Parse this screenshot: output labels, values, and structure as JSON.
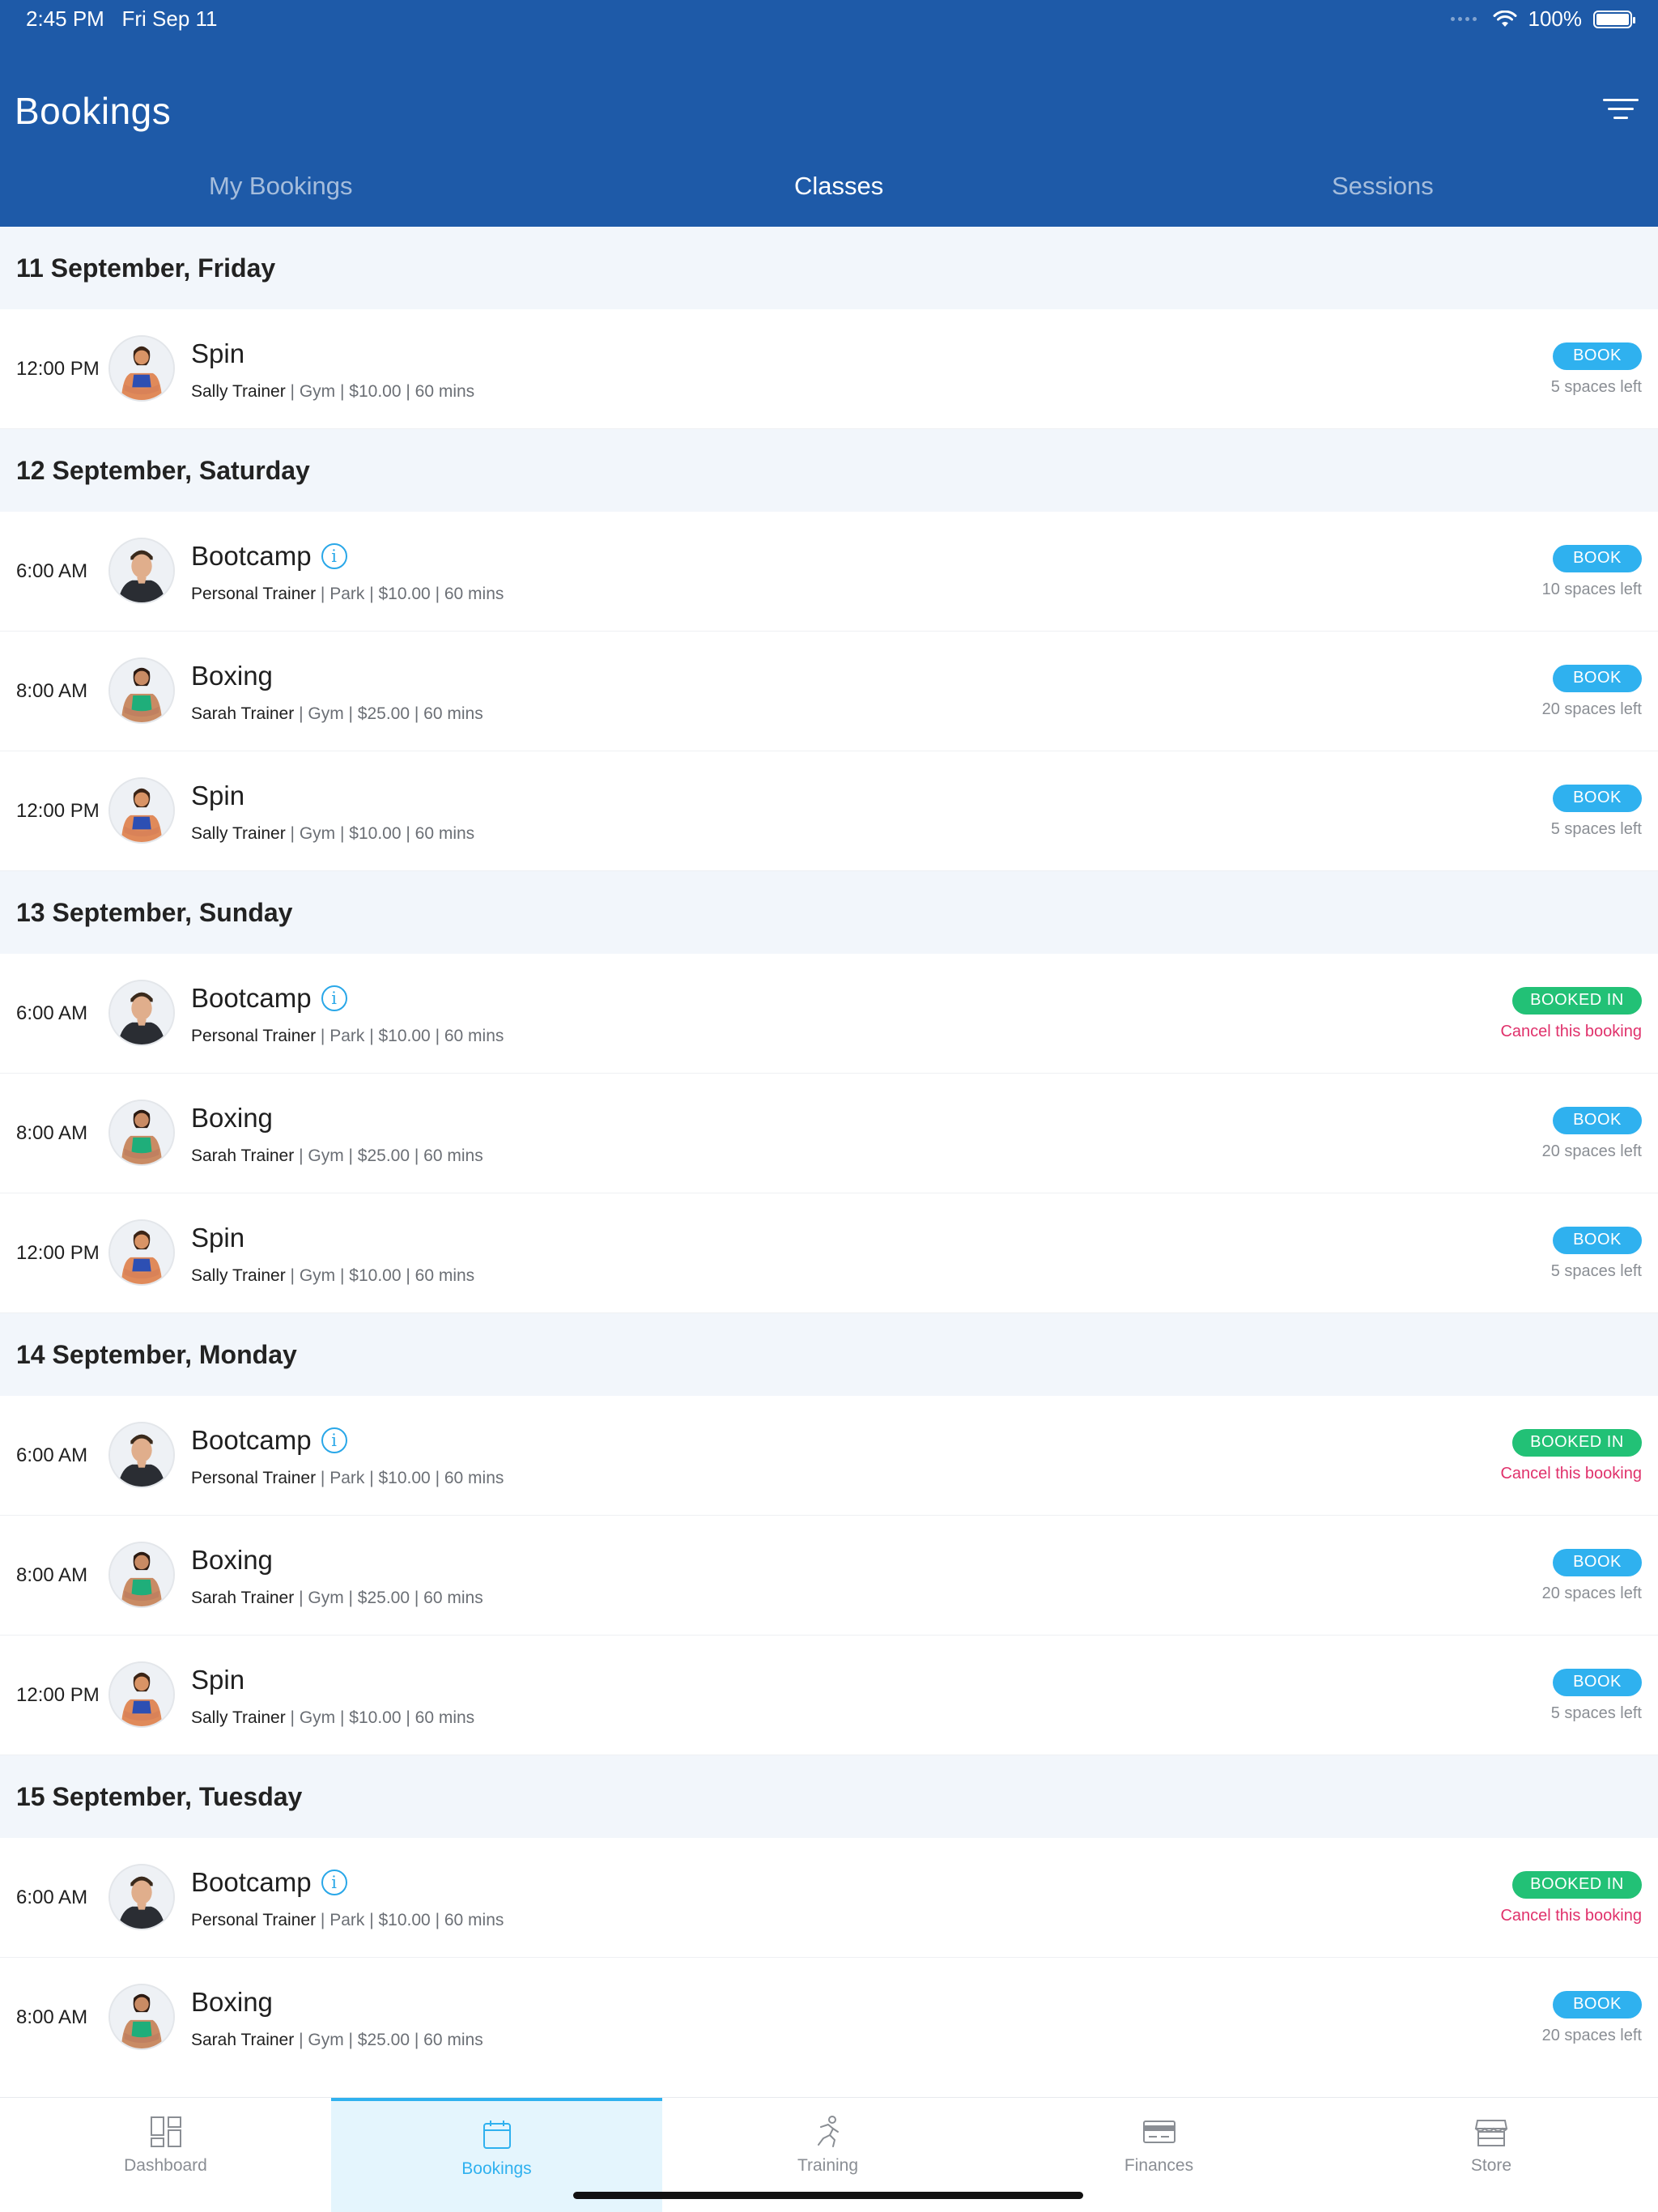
{
  "status_bar": {
    "time": "2:45 PM",
    "date": "Fri Sep 11",
    "battery": "100%"
  },
  "header": {
    "title": "Bookings"
  },
  "tabs": [
    {
      "label": "My Bookings",
      "active": false
    },
    {
      "label": "Classes",
      "active": true
    },
    {
      "label": "Sessions",
      "active": false
    }
  ],
  "colors": {
    "header": "#1e5aa8",
    "book": "#2fb1ef",
    "booked": "#22c176",
    "cancel": "#e0316b"
  },
  "days": [
    {
      "date": "11 September, Friday",
      "classes": [
        {
          "time": "12:00 PM",
          "title": "Spin",
          "info": false,
          "trainer": "Sally Trainer",
          "details": " | Gym | $10.00 | 60 mins",
          "status": "book",
          "button": "BOOK",
          "note": "5 spaces left",
          "avatar": "sally"
        }
      ]
    },
    {
      "date": "12 September, Saturday",
      "classes": [
        {
          "time": "6:00 AM",
          "title": "Bootcamp",
          "info": true,
          "trainer": "Personal Trainer",
          "details": " | Park | $10.00 | 60 mins",
          "status": "book",
          "button": "BOOK",
          "note": "10 spaces left",
          "avatar": "male"
        },
        {
          "time": "8:00 AM",
          "title": "Boxing",
          "info": false,
          "trainer": "Sarah Trainer",
          "details": " | Gym | $25.00 | 60 mins",
          "status": "book",
          "button": "BOOK",
          "note": "20 spaces left",
          "avatar": "sarah"
        },
        {
          "time": "12:00 PM",
          "title": "Spin",
          "info": false,
          "trainer": "Sally Trainer",
          "details": " | Gym | $10.00 | 60 mins",
          "status": "book",
          "button": "BOOK",
          "note": "5 spaces left",
          "avatar": "sally"
        }
      ]
    },
    {
      "date": "13 September, Sunday",
      "classes": [
        {
          "time": "6:00 AM",
          "title": "Bootcamp",
          "info": true,
          "trainer": "Personal Trainer",
          "details": " | Park | $10.00 | 60 mins",
          "status": "booked",
          "button": "BOOKED IN",
          "note": "Cancel this booking",
          "avatar": "male"
        },
        {
          "time": "8:00 AM",
          "title": "Boxing",
          "info": false,
          "trainer": "Sarah Trainer",
          "details": " | Gym | $25.00 | 60 mins",
          "status": "book",
          "button": "BOOK",
          "note": "20 spaces left",
          "avatar": "sarah"
        },
        {
          "time": "12:00 PM",
          "title": "Spin",
          "info": false,
          "trainer": "Sally Trainer",
          "details": " | Gym | $10.00 | 60 mins",
          "status": "book",
          "button": "BOOK",
          "note": "5 spaces left",
          "avatar": "sally"
        }
      ]
    },
    {
      "date": "14 September, Monday",
      "classes": [
        {
          "time": "6:00 AM",
          "title": "Bootcamp",
          "info": true,
          "trainer": "Personal Trainer",
          "details": " | Park | $10.00 | 60 mins",
          "status": "booked",
          "button": "BOOKED IN",
          "note": "Cancel this booking",
          "avatar": "male"
        },
        {
          "time": "8:00 AM",
          "title": "Boxing",
          "info": false,
          "trainer": "Sarah Trainer",
          "details": " | Gym | $25.00 | 60 mins",
          "status": "book",
          "button": "BOOK",
          "note": "20 spaces left",
          "avatar": "sarah"
        },
        {
          "time": "12:00 PM",
          "title": "Spin",
          "info": false,
          "trainer": "Sally Trainer",
          "details": " | Gym | $10.00 | 60 mins",
          "status": "book",
          "button": "BOOK",
          "note": "5 spaces left",
          "avatar": "sally"
        }
      ]
    },
    {
      "date": "15 September, Tuesday",
      "classes": [
        {
          "time": "6:00 AM",
          "title": "Bootcamp",
          "info": true,
          "trainer": "Personal Trainer",
          "details": " | Park | $10.00 | 60 mins",
          "status": "booked",
          "button": "BOOKED IN",
          "note": "Cancel this booking",
          "avatar": "male"
        },
        {
          "time": "8:00 AM",
          "title": "Boxing",
          "info": false,
          "trainer": "Sarah Trainer",
          "details": " | Gym | $25.00 | 60 mins",
          "status": "book",
          "button": "BOOK",
          "note": "20 spaces left",
          "avatar": "sarah"
        }
      ]
    }
  ],
  "bottom_nav": [
    {
      "label": "Dashboard",
      "icon": "dashboard-icon",
      "active": false
    },
    {
      "label": "Bookings",
      "icon": "calendar-icon",
      "active": true
    },
    {
      "label": "Training",
      "icon": "running-icon",
      "active": false
    },
    {
      "label": "Finances",
      "icon": "credit-card-icon",
      "active": false
    },
    {
      "label": "Store",
      "icon": "store-icon",
      "active": false
    }
  ]
}
